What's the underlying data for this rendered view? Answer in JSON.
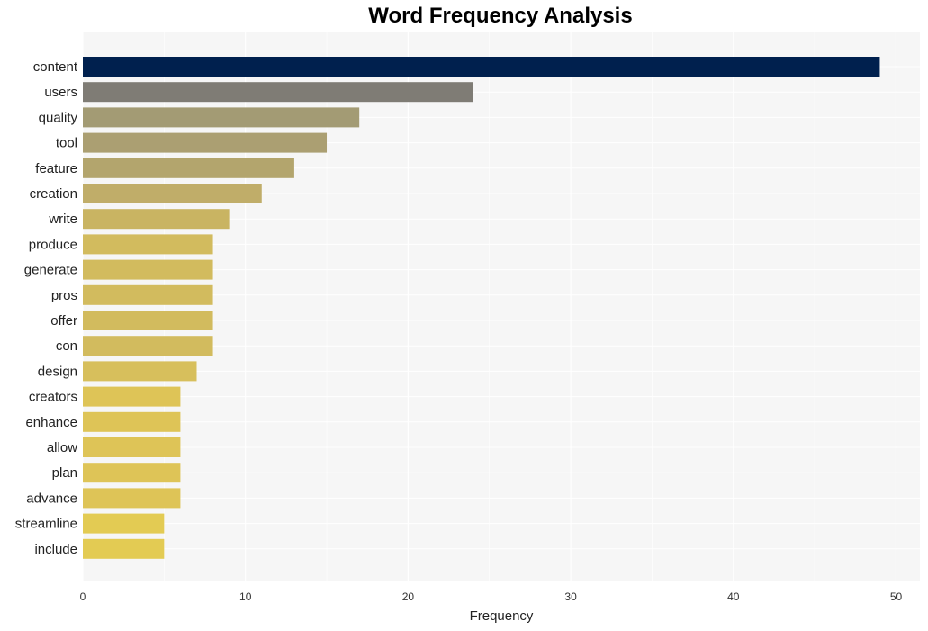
{
  "chart_data": {
    "type": "bar",
    "orientation": "horizontal",
    "title": "Word Frequency Analysis",
    "xlabel": "Frequency",
    "ylabel": "",
    "xlim": [
      0,
      51.5
    ],
    "xticks": [
      0,
      10,
      20,
      30,
      40,
      50
    ],
    "grid": true,
    "categories": [
      "content",
      "users",
      "quality",
      "tool",
      "feature",
      "creation",
      "write",
      "produce",
      "generate",
      "pros",
      "offer",
      "con",
      "design",
      "creators",
      "enhance",
      "allow",
      "plan",
      "advance",
      "streamline",
      "include"
    ],
    "values": [
      49,
      24,
      17,
      15,
      13,
      11,
      9,
      8,
      8,
      8,
      8,
      8,
      7,
      6,
      6,
      6,
      6,
      6,
      5,
      5
    ],
    "colors": [
      "#00204e",
      "#7f7c75",
      "#a39b74",
      "#ab9f72",
      "#b3a56d",
      "#c0ad69",
      "#c9b462",
      "#d2bb5e",
      "#d2bb5e",
      "#d2bb5e",
      "#d2bb5e",
      "#d2bb5e",
      "#d7bf5c",
      "#dec457",
      "#dec457",
      "#dec457",
      "#dec457",
      "#dec457",
      "#e3cb53",
      "#e3cb53"
    ],
    "background": "#f6f6f6"
  }
}
